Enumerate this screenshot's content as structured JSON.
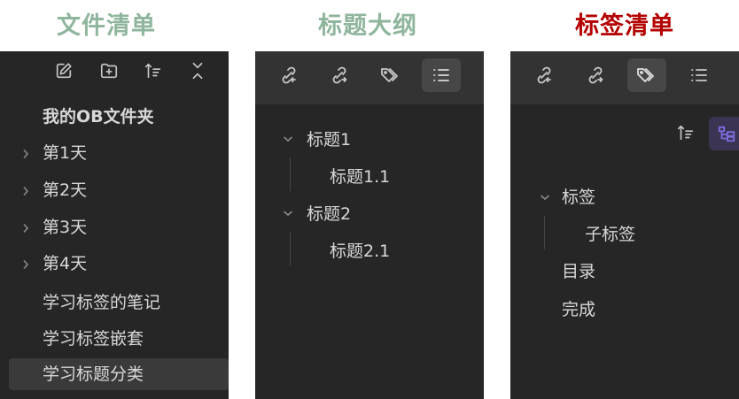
{
  "colors": {
    "heading_green": "#8fb59c",
    "heading_red": "#b40000",
    "accent_purple": "#7c6ce0"
  },
  "headings": {
    "files": "文件清单",
    "outline": "标题大纲",
    "tags": "标签清单"
  },
  "file_explorer": {
    "toolbar_icons": [
      "new-note-icon",
      "new-folder-icon",
      "sort-icon",
      "collapse-all-icon"
    ],
    "root": "我的OB文件夹",
    "items": [
      {
        "label": "第1天",
        "type": "folder"
      },
      {
        "label": "第2天",
        "type": "folder"
      },
      {
        "label": "第3天",
        "type": "folder"
      },
      {
        "label": "第4天",
        "type": "folder"
      },
      {
        "label": "学习标签的笔记",
        "type": "file"
      },
      {
        "label": "学习标签嵌套",
        "type": "file"
      },
      {
        "label": "学习标题分类",
        "type": "file",
        "selected": true
      }
    ]
  },
  "outline": {
    "toolbar_icons": [
      "backlinks-icon",
      "outgoing-links-icon",
      "tags-icon",
      "outline-icon"
    ],
    "active_tab": "outline-icon",
    "items": [
      {
        "label": "标题1",
        "children": [
          {
            "label": "标题1.1"
          }
        ]
      },
      {
        "label": "标题2",
        "children": [
          {
            "label": "标题2.1"
          }
        ]
      }
    ]
  },
  "tags": {
    "toolbar_icons": [
      "backlinks-icon",
      "outgoing-links-icon",
      "tags-icon",
      "outline-icon"
    ],
    "active_tab": "tags-icon",
    "sub_icons": [
      "sort-icon",
      "tree-view-icon"
    ],
    "items": [
      {
        "label": "标签",
        "children": [
          {
            "label": "子标签"
          }
        ]
      },
      {
        "label": "目录"
      },
      {
        "label": "完成"
      }
    ]
  }
}
